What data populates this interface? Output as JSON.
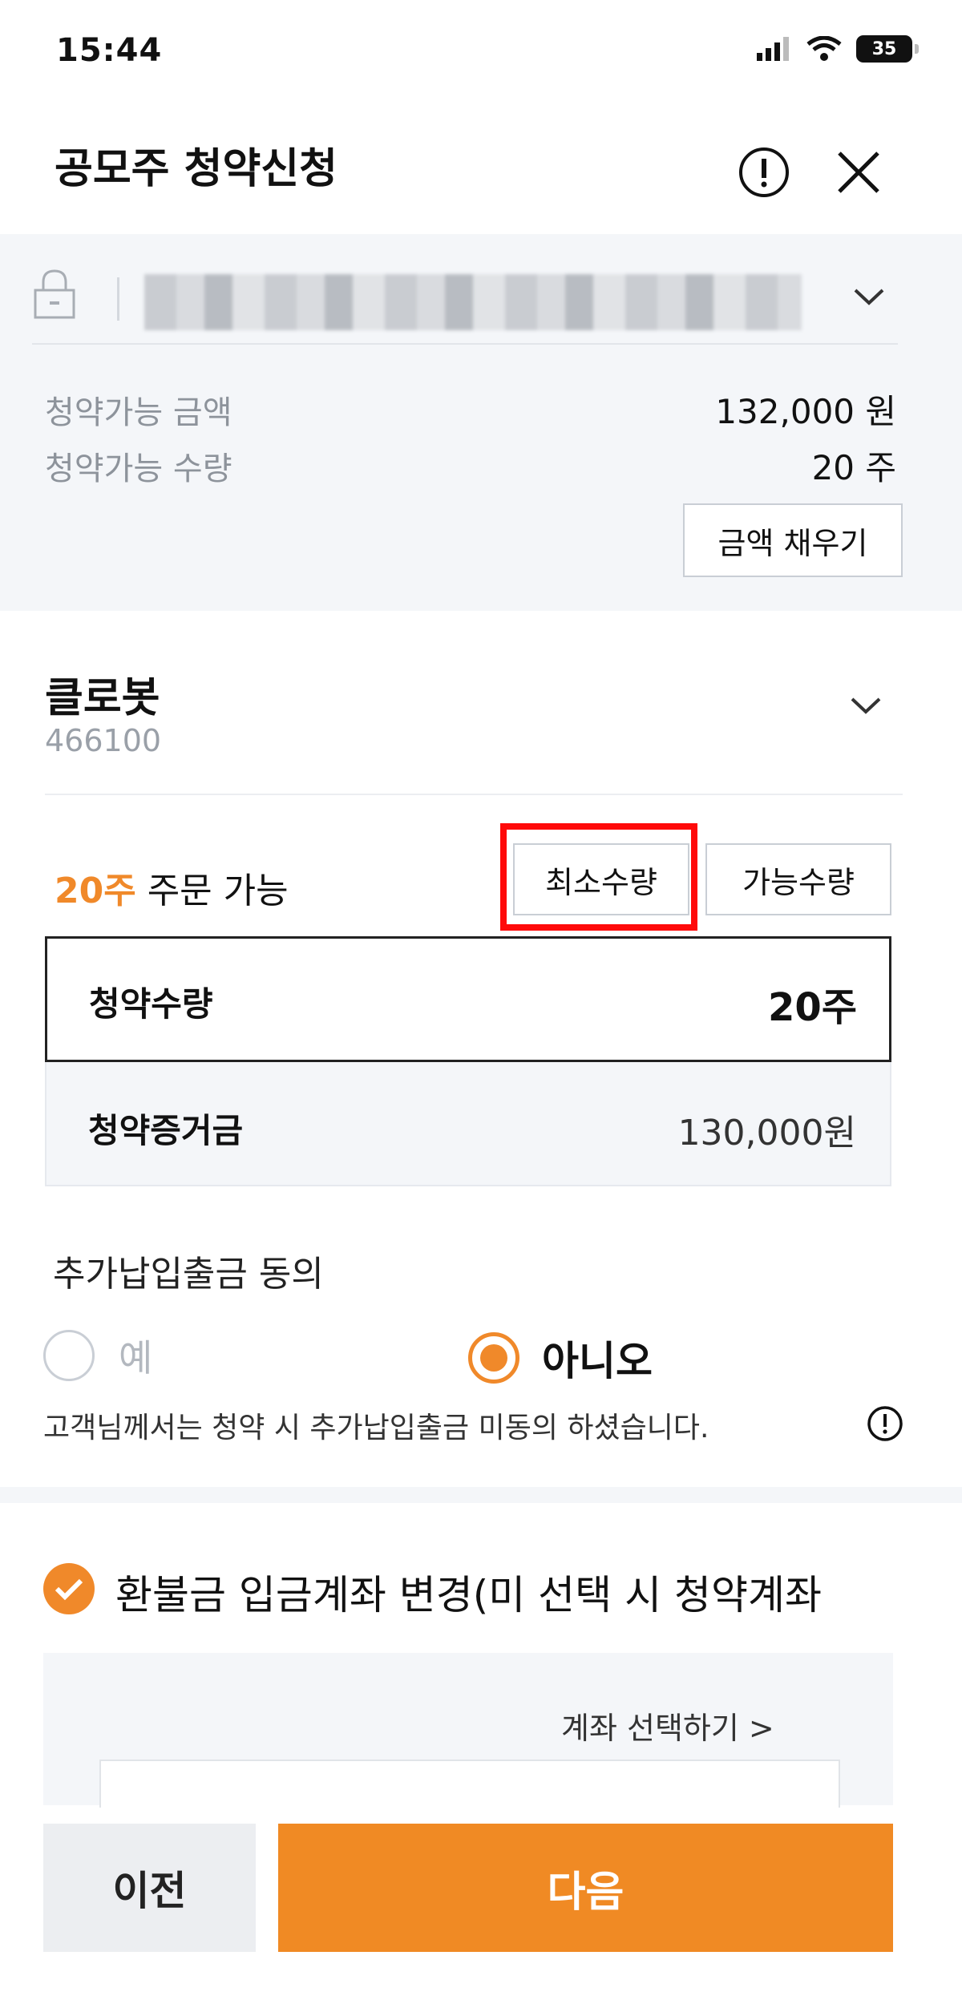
{
  "status_bar": {
    "time": "15:44",
    "battery": "35"
  },
  "header": {
    "title": "공모주 청약신청"
  },
  "account": {
    "available_amount_label": "청약가능 금액",
    "available_amount_value": "132,000 원",
    "available_qty_label": "청약가능 수량",
    "available_qty_value": "20 주",
    "fill_amount_button": "금액 채우기"
  },
  "stock": {
    "name": "클로봇",
    "code": "466100"
  },
  "order": {
    "available_count": "20주",
    "available_suffix": " 주문 가능",
    "min_qty_button": "최소수량",
    "max_qty_button": "가능수량",
    "qty_label": "청약수량",
    "qty_value": "20주",
    "deposit_label": "청약증거금",
    "deposit_value": "130,000원"
  },
  "consent": {
    "title": "추가납입출금 동의",
    "option_yes": "예",
    "option_no": "아니오",
    "selected": "아니오",
    "note": "고객님께서는 청약 시 추가납입출금 미동의 하셨습니다."
  },
  "refund": {
    "label": "환불금 입금계좌 변경(미 선택 시 청약계좌",
    "select_account": "계좌 선택하기 >"
  },
  "footer": {
    "prev_button": "이전",
    "next_button": "다음"
  },
  "colors": {
    "accent": "#f08a24",
    "highlight": "#ff0a0a"
  }
}
